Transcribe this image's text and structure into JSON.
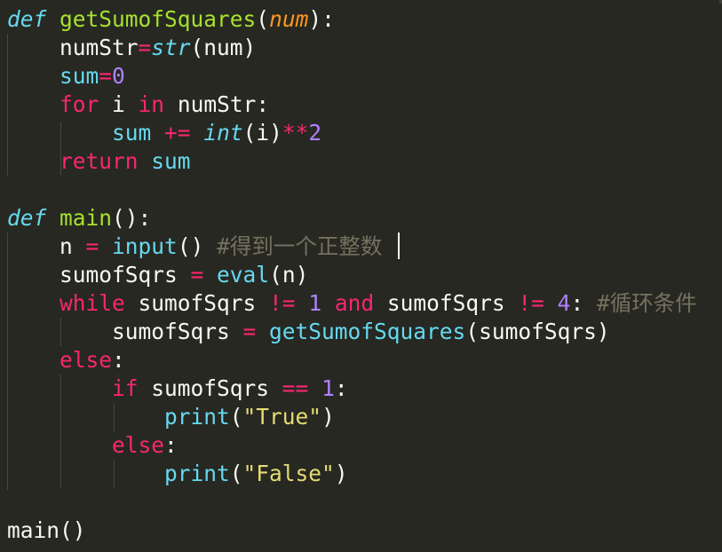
{
  "editor": {
    "language": "python",
    "theme": "monokai",
    "colors": {
      "background": "#272822",
      "plain": "#F8F8F2",
      "keyword": "#F92672",
      "storage": "#66D9EF",
      "function_name": "#A6E22E",
      "parameter": "#FD971F",
      "number": "#AE81FF",
      "string": "#E6DB74",
      "comment": "#75715E"
    },
    "lines": [
      [
        {
          "text": "def",
          "type": "storage-italic"
        },
        {
          "text": " ",
          "type": "plain"
        },
        {
          "text": "getSumofSquares",
          "type": "function_name"
        },
        {
          "text": "(",
          "type": "plain"
        },
        {
          "text": "num",
          "type": "parameter"
        },
        {
          "text": "):",
          "type": "plain"
        }
      ],
      [
        {
          "text": "    numStr",
          "type": "plain"
        },
        {
          "text": "=",
          "type": "keyword"
        },
        {
          "text": "str",
          "type": "storage-italic"
        },
        {
          "text": "(num)",
          "type": "plain"
        }
      ],
      [
        {
          "text": "    ",
          "type": "plain"
        },
        {
          "text": "sum",
          "type": "storage"
        },
        {
          "text": "=",
          "type": "keyword"
        },
        {
          "text": "0",
          "type": "number"
        }
      ],
      [
        {
          "text": "    ",
          "type": "plain"
        },
        {
          "text": "for",
          "type": "keyword"
        },
        {
          "text": " i ",
          "type": "plain"
        },
        {
          "text": "in",
          "type": "keyword"
        },
        {
          "text": " numStr:",
          "type": "plain"
        }
      ],
      [
        {
          "text": "        ",
          "type": "plain"
        },
        {
          "text": "sum",
          "type": "storage"
        },
        {
          "text": " ",
          "type": "plain"
        },
        {
          "text": "+=",
          "type": "keyword"
        },
        {
          "text": " ",
          "type": "plain"
        },
        {
          "text": "int",
          "type": "storage-italic"
        },
        {
          "text": "(i)",
          "type": "plain"
        },
        {
          "text": "**",
          "type": "keyword"
        },
        {
          "text": "2",
          "type": "number"
        }
      ],
      [
        {
          "text": "    ",
          "type": "plain"
        },
        {
          "text": "return",
          "type": "keyword"
        },
        {
          "text": " ",
          "type": "plain"
        },
        {
          "text": "sum",
          "type": "storage"
        }
      ],
      [],
      [
        {
          "text": "def",
          "type": "storage-italic"
        },
        {
          "text": " ",
          "type": "plain"
        },
        {
          "text": "main",
          "type": "function_name"
        },
        {
          "text": "():",
          "type": "plain"
        }
      ],
      [
        {
          "text": "    n ",
          "type": "plain"
        },
        {
          "text": "=",
          "type": "keyword"
        },
        {
          "text": " ",
          "type": "plain"
        },
        {
          "text": "input",
          "type": "storage"
        },
        {
          "text": "() ",
          "type": "plain"
        },
        {
          "text": "#得到一个正整数",
          "type": "comment"
        }
      ],
      [
        {
          "text": "    sumofSqrs ",
          "type": "plain"
        },
        {
          "text": "=",
          "type": "keyword"
        },
        {
          "text": " ",
          "type": "plain"
        },
        {
          "text": "eval",
          "type": "storage"
        },
        {
          "text": "(n)",
          "type": "plain"
        }
      ],
      [
        {
          "text": "    ",
          "type": "plain"
        },
        {
          "text": "while",
          "type": "keyword"
        },
        {
          "text": " sumofSqrs ",
          "type": "plain"
        },
        {
          "text": "!=",
          "type": "keyword"
        },
        {
          "text": " ",
          "type": "plain"
        },
        {
          "text": "1",
          "type": "number"
        },
        {
          "text": " ",
          "type": "plain"
        },
        {
          "text": "and",
          "type": "keyword"
        },
        {
          "text": " sumofSqrs ",
          "type": "plain"
        },
        {
          "text": "!=",
          "type": "keyword"
        },
        {
          "text": " ",
          "type": "plain"
        },
        {
          "text": "4",
          "type": "number"
        },
        {
          "text": ": ",
          "type": "plain"
        },
        {
          "text": "#循环条件",
          "type": "comment"
        }
      ],
      [
        {
          "text": "        sumofSqrs ",
          "type": "plain"
        },
        {
          "text": "=",
          "type": "keyword"
        },
        {
          "text": " ",
          "type": "plain"
        },
        {
          "text": "getSumofSquares",
          "type": "storage"
        },
        {
          "text": "(sumofSqrs)",
          "type": "plain"
        }
      ],
      [
        {
          "text": "    ",
          "type": "plain"
        },
        {
          "text": "else",
          "type": "keyword"
        },
        {
          "text": ":",
          "type": "plain"
        }
      ],
      [
        {
          "text": "        ",
          "type": "plain"
        },
        {
          "text": "if",
          "type": "keyword"
        },
        {
          "text": " sumofSqrs ",
          "type": "plain"
        },
        {
          "text": "==",
          "type": "keyword"
        },
        {
          "text": " ",
          "type": "plain"
        },
        {
          "text": "1",
          "type": "number"
        },
        {
          "text": ":",
          "type": "plain"
        }
      ],
      [
        {
          "text": "            ",
          "type": "plain"
        },
        {
          "text": "print",
          "type": "storage"
        },
        {
          "text": "(",
          "type": "plain"
        },
        {
          "text": "\"True\"",
          "type": "string"
        },
        {
          "text": ")",
          "type": "plain"
        }
      ],
      [
        {
          "text": "        ",
          "type": "plain"
        },
        {
          "text": "else",
          "type": "keyword"
        },
        {
          "text": ":",
          "type": "plain"
        }
      ],
      [
        {
          "text": "            ",
          "type": "plain"
        },
        {
          "text": "print",
          "type": "storage"
        },
        {
          "text": "(",
          "type": "plain"
        },
        {
          "text": "\"False\"",
          "type": "string"
        },
        {
          "text": ")",
          "type": "plain"
        }
      ],
      [],
      [
        {
          "text": "main()",
          "type": "plain"
        }
      ]
    ]
  }
}
